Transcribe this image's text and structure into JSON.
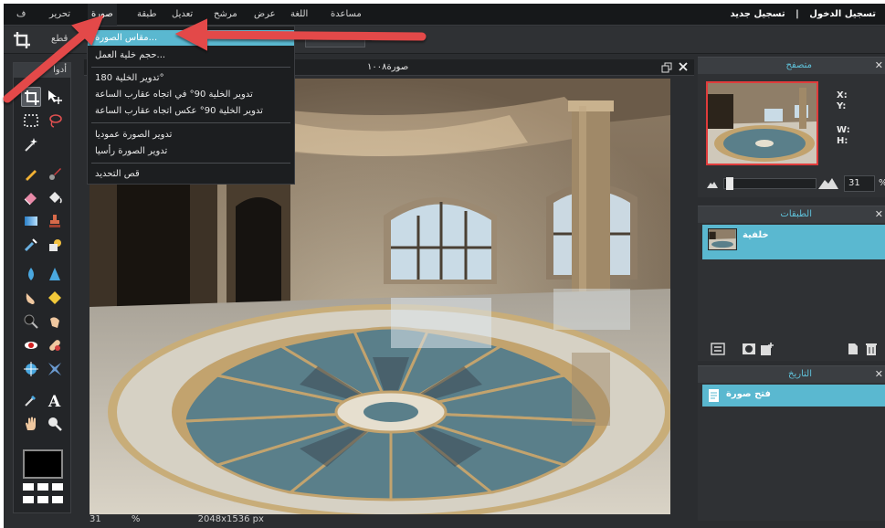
{
  "menubar": {
    "items": [
      "ف",
      "تحرير",
      "صورة",
      "طبقة",
      "تعديل",
      "مرشح",
      "عرض",
      "اللغة",
      "مساعدة"
    ],
    "account": {
      "signup": "تسجيل جديد",
      "separator": "|",
      "login": "تسجيل الدخول"
    }
  },
  "optionsbar": {
    "label": "قطع"
  },
  "tools": {
    "header": "أدوا"
  },
  "image_menu": {
    "items": [
      "مقاس الصورة...",
      "حجم خلية العمل...",
      "تدوير الخلية 180°",
      "تدوير الخلية 90° في اتجاه عقارب الساعة",
      "تدوير الخلية 90° عكس اتجاه عقارب الساعة",
      "تدوير الصورة عموديا",
      "تدوير الصورة رأسيا",
      "قص التحديد"
    ],
    "highlighted_index": 0
  },
  "document": {
    "title": "صورة١٠٠٨",
    "zoom": "31",
    "zoom_unit": "%",
    "dimensions": "2048x1536 px"
  },
  "navigator": {
    "title": "متصفح",
    "x_label": "X:",
    "y_label": "Y:",
    "w_label": "W:",
    "h_label": "H:",
    "zoom": "31",
    "zoom_unit": "%"
  },
  "layers": {
    "title": "الطبقات",
    "items": [
      {
        "name": "خلفية"
      }
    ]
  },
  "history": {
    "title": "التاريخ",
    "items": [
      {
        "label": "فتح صورة"
      }
    ]
  },
  "colors": {
    "accent": "#5ab8d0",
    "arrow": "#e34848",
    "background": "#2b2d30"
  }
}
